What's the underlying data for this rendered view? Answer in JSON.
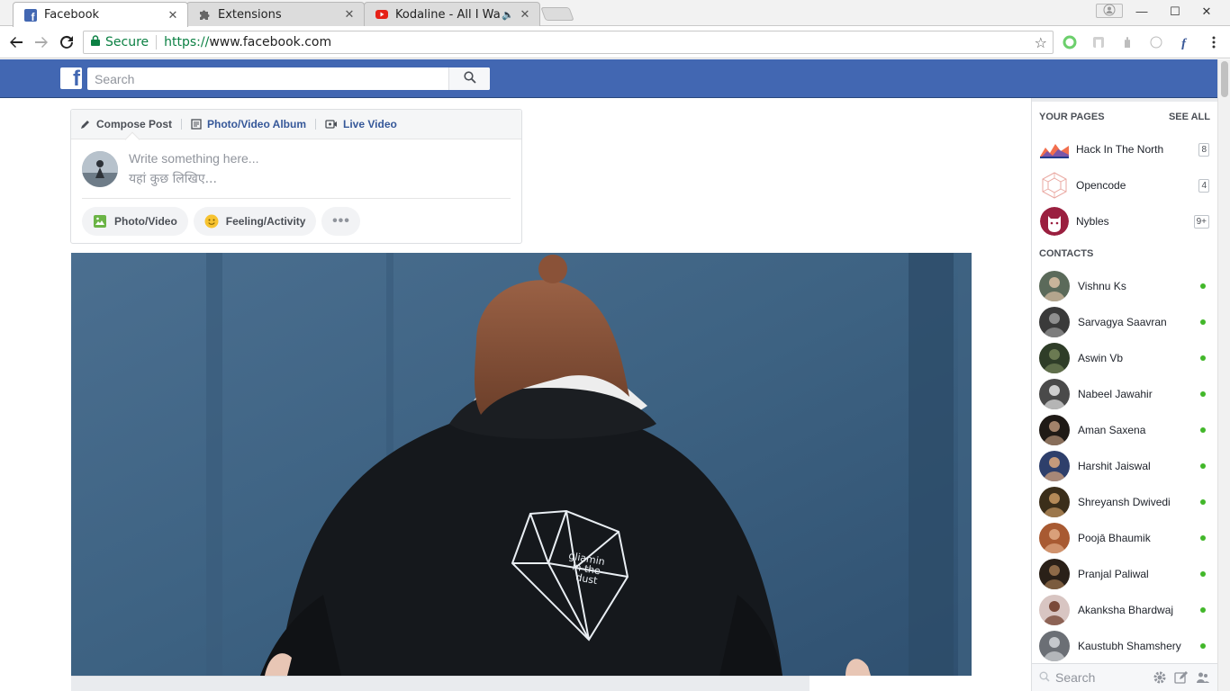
{
  "browser": {
    "tabs": [
      {
        "title": "Facebook",
        "favicon": "facebook-icon",
        "active": true
      },
      {
        "title": "Extensions",
        "favicon": "puzzle-icon",
        "active": false
      },
      {
        "title": "Kodaline - All I Want",
        "favicon": "youtube-icon",
        "active": false,
        "audio": true
      }
    ],
    "address": {
      "secure_label": "Secure",
      "scheme": "https://",
      "host": "www.facebook.com"
    },
    "colors": {
      "secure_green": "#0b8043"
    }
  },
  "facebook": {
    "brand_color": "#4267b2",
    "logo": "f",
    "search_placeholder": "Search",
    "composer": {
      "tabs": [
        "Compose Post",
        "Photo/Video Album",
        "Live Video"
      ],
      "placeholder_en": "Write something here...",
      "placeholder_hi": "यहां कुछ लिखिए...",
      "actions": [
        "Photo/Video",
        "Feeling/Activity"
      ],
      "more": "•••"
    },
    "sidebar": {
      "pages_header": "YOUR PAGES",
      "see_all": "SEE ALL",
      "pages": [
        {
          "name": "Hack In The North",
          "count": "8"
        },
        {
          "name": "Opencode",
          "count": "4"
        },
        {
          "name": "Nybles",
          "count": "9+"
        }
      ],
      "contacts_header": "CONTACTS",
      "contacts": [
        {
          "name": "Vishnu Ks",
          "online": true
        },
        {
          "name": "Sarvagya Saavran",
          "online": true
        },
        {
          "name": "Aswin Vb",
          "online": true
        },
        {
          "name": "Nabeel Jawahir",
          "online": true
        },
        {
          "name": "Aman Saxena",
          "online": true
        },
        {
          "name": "Harshit Jaiswal",
          "online": true
        },
        {
          "name": "Shreyansh Dwivedi",
          "online": true
        },
        {
          "name": "Poojā Bhaumik",
          "online": true
        },
        {
          "name": "Pranjal Paliwal",
          "online": true
        },
        {
          "name": "Akanksha Bhardwaj",
          "online": true
        },
        {
          "name": "Kaustubh Shamshery",
          "online": true
        }
      ],
      "chat_search": "Search",
      "online_color": "#42b72a"
    }
  }
}
